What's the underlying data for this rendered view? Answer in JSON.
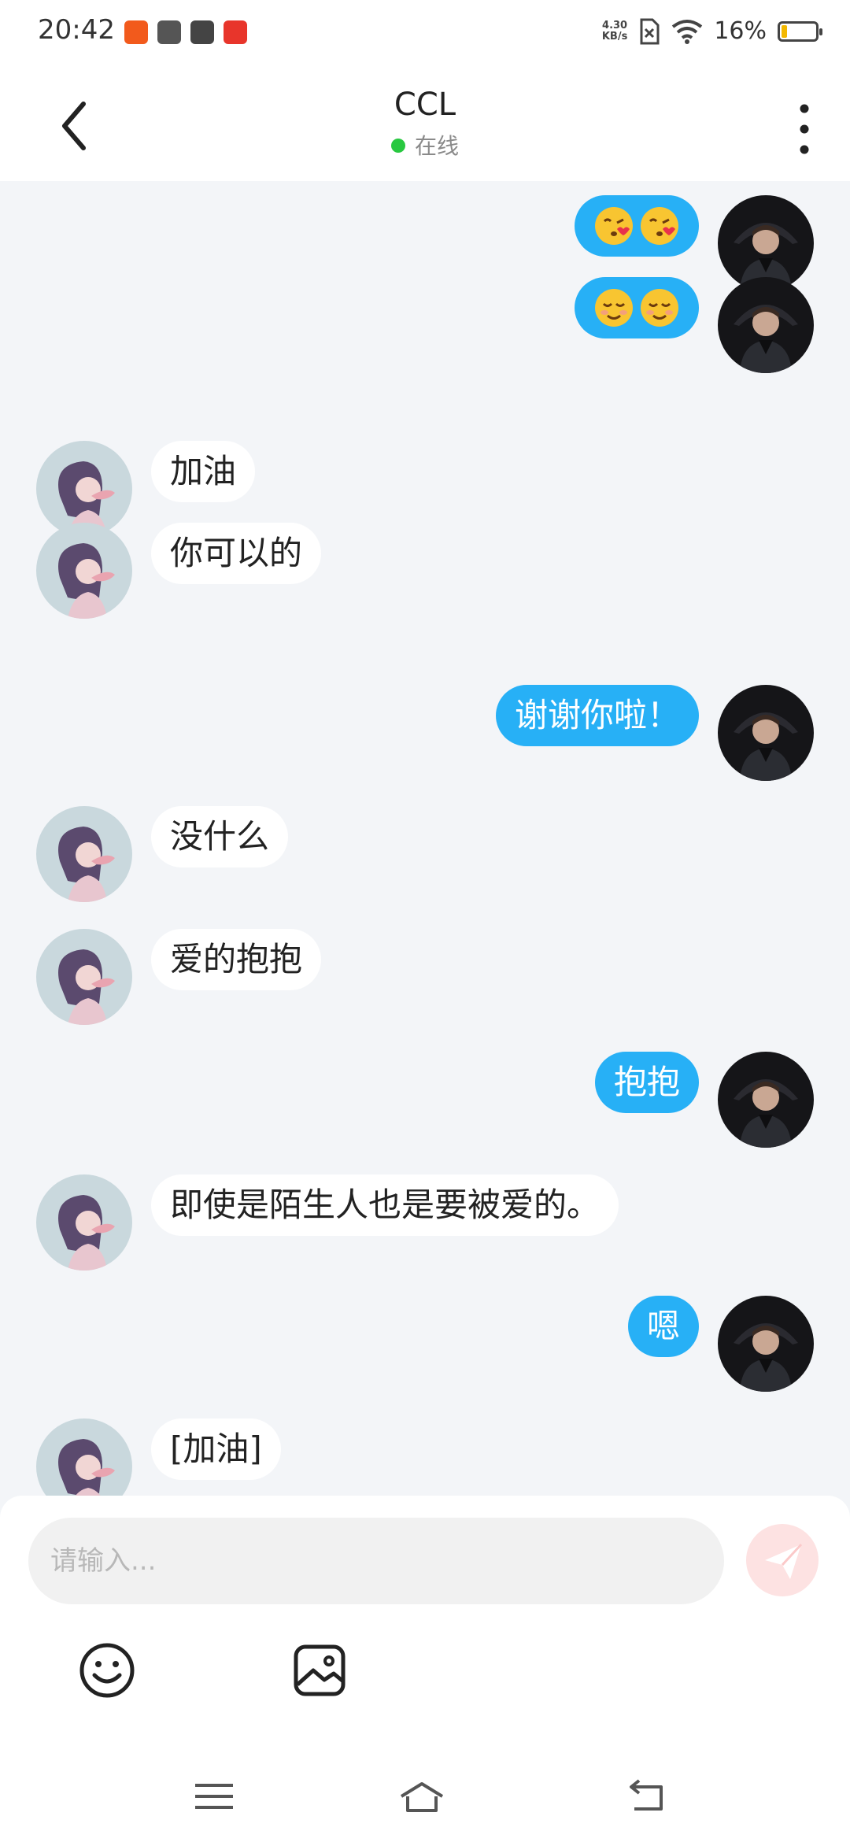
{
  "status_bar": {
    "time": "20:42",
    "net_speed_value": "4.30",
    "net_speed_unit": "KB/s",
    "battery_percent": "16%",
    "battery_level": 0.16,
    "app_icons": [
      "kuaishou-icon",
      "video-app-icon",
      "book-app-icon",
      "game-app-icon"
    ]
  },
  "header": {
    "title": "CCL",
    "presence": "在线",
    "back_icon": "chevron-left-icon",
    "more_icon": "more-vertical-icon"
  },
  "messages": [
    {
      "side": "right",
      "type": "emoji",
      "emojis": [
        "kissing-heart-emoji",
        "kissing-heart-emoji"
      ]
    },
    {
      "side": "right",
      "type": "emoji",
      "emojis": [
        "smiling-blush-emoji",
        "smiling-blush-emoji"
      ]
    },
    {
      "side": "left",
      "type": "text",
      "text": "加油"
    },
    {
      "side": "left",
      "type": "text",
      "text": "你可以的"
    },
    {
      "side": "right",
      "type": "text",
      "text": "谢谢你啦！"
    },
    {
      "side": "left",
      "type": "text",
      "text": "没什么"
    },
    {
      "side": "left",
      "type": "text",
      "text": "爱的抱抱"
    },
    {
      "side": "right",
      "type": "text",
      "text": "抱抱"
    },
    {
      "side": "left",
      "type": "text",
      "text": "即使是陌生人也是要被爱的。"
    },
    {
      "side": "right",
      "type": "text",
      "text": "嗯"
    },
    {
      "side": "left",
      "type": "text",
      "text": "[加油]"
    }
  ],
  "input": {
    "placeholder": "请输入...",
    "send_icon": "send-icon",
    "emoji_tool_icon": "smiley-icon",
    "image_tool_icon": "image-icon"
  },
  "nav_bar": {
    "icons": [
      "menu-icon",
      "home-icon",
      "back-nav-icon"
    ]
  },
  "colors": {
    "sent_bubble": "#27b0f6",
    "received_bubble": "#ffffff",
    "background": "#f3f5f8",
    "online_dot": "#28c840",
    "send_button": "#fde2e2"
  }
}
